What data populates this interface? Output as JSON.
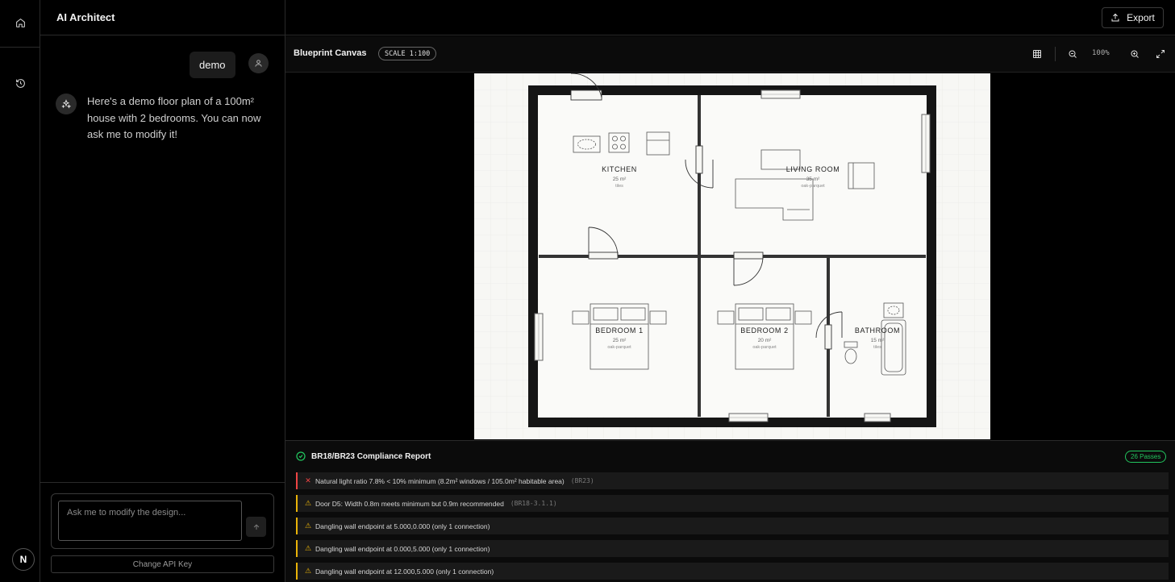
{
  "app": {
    "title": "AI Architect"
  },
  "rail": {
    "logo": "N",
    "icons": [
      "home-icon",
      "history-icon"
    ]
  },
  "chat": {
    "user_message": "demo",
    "ai_message": "Here's a demo floor plan of a 100m² house with 2 bedrooms. You can now ask me to modify it!",
    "input_placeholder": "Ask me to modify the design...",
    "api_key_label": "Change API Key"
  },
  "topbar": {
    "export_label": "Export"
  },
  "toolbar": {
    "title": "Blueprint Canvas",
    "scale": "SCALE 1:100",
    "zoom": "100%"
  },
  "plan": {
    "rooms": [
      {
        "name": "KITCHEN",
        "area": "25 m²",
        "material": "tiles"
      },
      {
        "name": "LIVING ROOM",
        "area": "35 m²",
        "material": "oak-parquet"
      },
      {
        "name": "BEDROOM 1",
        "area": "25 m²",
        "material": "oak-parquet"
      },
      {
        "name": "BEDROOM 2",
        "area": "20 m²",
        "material": "oak-parquet"
      },
      {
        "name": "BATHROOM",
        "area": "15 m²",
        "material": "tiles"
      }
    ]
  },
  "report": {
    "title": "BR18/BR23 Compliance Report",
    "passes": "26 Passes",
    "issues": [
      {
        "level": "error",
        "text": "Natural light ratio 7.8% < 10% minimum (8.2m² windows / 105.0m² habitable area)",
        "code": "(BR23)"
      },
      {
        "level": "warning",
        "text": "Door D5: Width 0.8m meets minimum but 0.9m recommended",
        "code": "(BR18-3.1.1)"
      },
      {
        "level": "warning",
        "text": "Dangling wall endpoint at 5.000,0.000 (only 1 connection)",
        "code": ""
      },
      {
        "level": "warning",
        "text": "Dangling wall endpoint at 0.000,5.000 (only 1 connection)",
        "code": ""
      },
      {
        "level": "warning",
        "text": "Dangling wall endpoint at 12.000,5.000 (only 1 connection)",
        "code": ""
      }
    ]
  }
}
